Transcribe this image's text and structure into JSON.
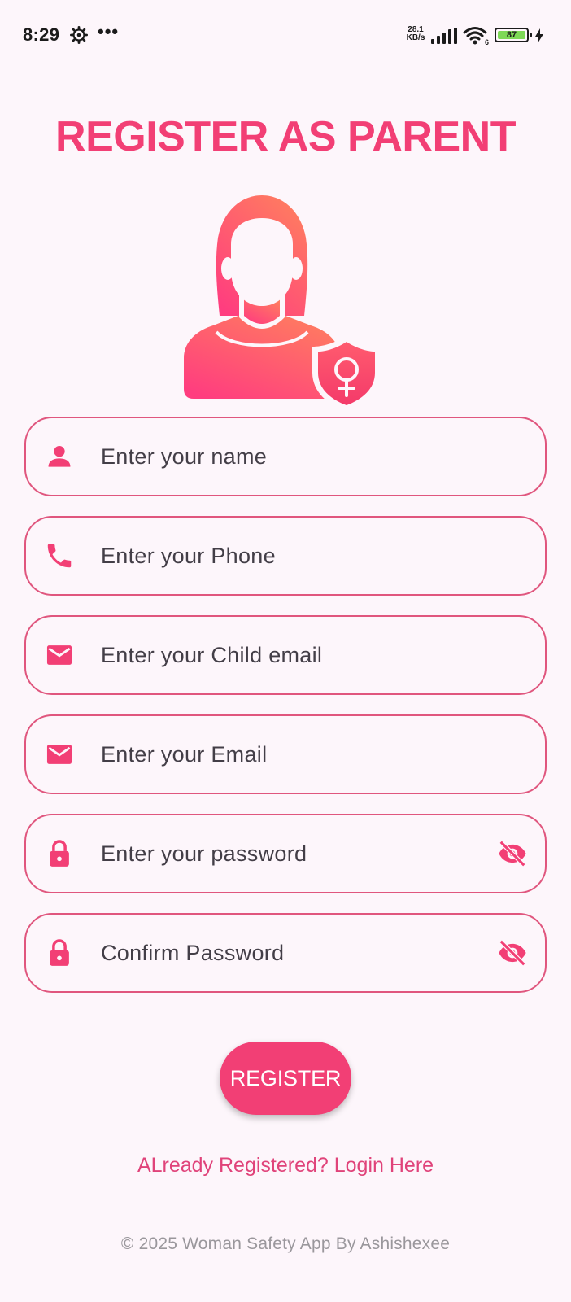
{
  "status_bar": {
    "time": "8:29",
    "dots": "•••",
    "speed_value": "28.1",
    "speed_unit": "KB/s",
    "wifi_badge": "6",
    "battery": "87",
    "battery_color": "#7ed957"
  },
  "title": "REGISTER AS PARENT",
  "illustration_icon": "woman-with-shield-venus-icon",
  "fields": [
    {
      "icon": "person-icon",
      "placeholder": "Enter your name",
      "value": ""
    },
    {
      "icon": "phone-icon",
      "placeholder": "Enter your Phone",
      "value": ""
    },
    {
      "icon": "email-icon",
      "placeholder": "Enter your Child email",
      "value": ""
    },
    {
      "icon": "email-icon",
      "placeholder": "Enter your Email",
      "value": ""
    },
    {
      "icon": "lock-icon",
      "placeholder": "Enter your password",
      "value": "",
      "trailing_icon": "eye-off-icon"
    },
    {
      "icon": "lock-icon",
      "placeholder": "Confirm Password",
      "value": "",
      "trailing_icon": "eye-off-icon"
    }
  ],
  "register_button": "REGISTER",
  "login_link": "ALready Registered? Login Here",
  "footer": "© 2025 Woman Safety App By Ashishexee",
  "colors": {
    "accent": "#F23F75",
    "field_border": "#E0567E",
    "background": "#FDF6FB",
    "gradient_start": "#FF7E5F",
    "gradient_end": "#FF3D7F"
  }
}
